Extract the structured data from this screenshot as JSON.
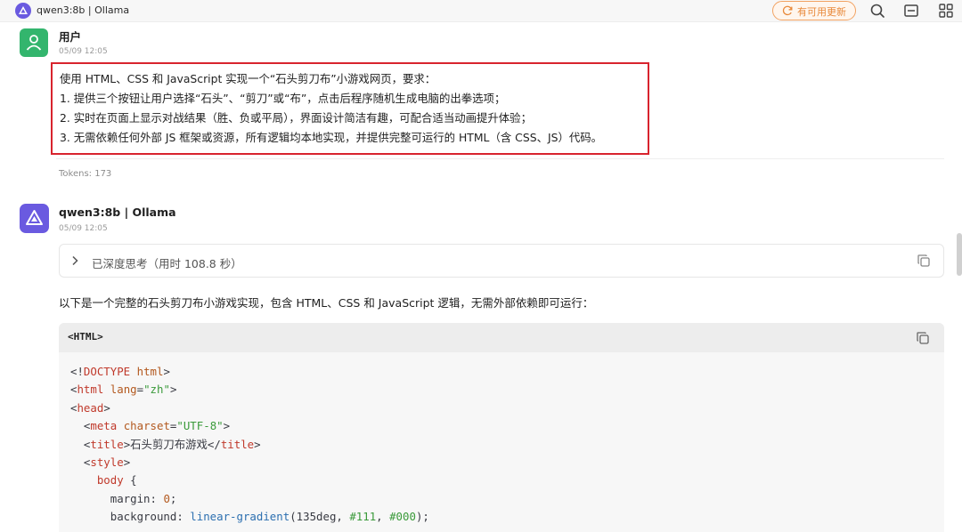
{
  "window": {
    "title": "qwen3:8b | Ollama",
    "update_button": "有可用更新",
    "icons": [
      "refresh-icon",
      "search-icon",
      "layout-icon",
      "grid-icon"
    ]
  },
  "user_message": {
    "sender": "用户",
    "timestamp": "05/09 12:05",
    "lines": [
      "使用 HTML、CSS 和 JavaScript 实现一个“石头剪刀布”小游戏网页，要求：",
      "1. 提供三个按钮让用户选择“石头”、“剪刀”或“布”，点击后程序随机生成电脑的出拳选项；",
      "2. 实时在页面上显示对战结果（胜、负或平局），界面设计简洁有趣，可配合适当动画提升体验；",
      "3. 无需依赖任何外部 JS 框架或资源，所有逻辑均本地实现，并提供完整可运行的 HTML（含 CSS、JS）代码。"
    ],
    "tokens": "Tokens: 173"
  },
  "assistant_message": {
    "sender": "qwen3:8b | Ollama",
    "timestamp": "05/09 12:05",
    "thinking_label": "已深度思考（用时 108.8 秒）",
    "intro": "以下是一个完整的石头剪刀布小游戏实现，包含 HTML、CSS 和 JavaScript 逻辑，无需外部依赖即可运行：",
    "code_lang": "<HTML>",
    "code_lines": [
      [
        {
          "t": "<!",
          "c": "plain"
        },
        {
          "t": "DOCTYPE",
          "c": "tag"
        },
        {
          "t": " ",
          "c": "plain"
        },
        {
          "t": "html",
          "c": "attr"
        },
        {
          "t": ">",
          "c": "plain"
        }
      ],
      [
        {
          "t": "<",
          "c": "plain"
        },
        {
          "t": "html",
          "c": "tag"
        },
        {
          "t": " ",
          "c": "plain"
        },
        {
          "t": "lang",
          "c": "attr"
        },
        {
          "t": "=",
          "c": "plain"
        },
        {
          "t": "\"zh\"",
          "c": "str"
        },
        {
          "t": ">",
          "c": "plain"
        }
      ],
      [
        {
          "t": "<",
          "c": "plain"
        },
        {
          "t": "head",
          "c": "tag"
        },
        {
          "t": ">",
          "c": "plain"
        }
      ],
      [
        {
          "t": "  <",
          "c": "plain"
        },
        {
          "t": "meta",
          "c": "tag"
        },
        {
          "t": " ",
          "c": "plain"
        },
        {
          "t": "charset",
          "c": "attr"
        },
        {
          "t": "=",
          "c": "plain"
        },
        {
          "t": "\"UTF-8\"",
          "c": "str"
        },
        {
          "t": ">",
          "c": "plain"
        }
      ],
      [
        {
          "t": "  <",
          "c": "plain"
        },
        {
          "t": "title",
          "c": "tag"
        },
        {
          "t": ">石头剪刀布游戏</",
          "c": "plain"
        },
        {
          "t": "title",
          "c": "tag"
        },
        {
          "t": ">",
          "c": "plain"
        }
      ],
      [
        {
          "t": "  <",
          "c": "plain"
        },
        {
          "t": "style",
          "c": "tag"
        },
        {
          "t": ">",
          "c": "plain"
        }
      ],
      [
        {
          "t": "    ",
          "c": "plain"
        },
        {
          "t": "body",
          "c": "tag"
        },
        {
          "t": " {",
          "c": "plain"
        }
      ],
      [
        {
          "t": "      margin",
          "c": "prop"
        },
        {
          "t": ": ",
          "c": "plain"
        },
        {
          "t": "0",
          "c": "num"
        },
        {
          "t": ";",
          "c": "plain"
        }
      ],
      [
        {
          "t": "      background",
          "c": "prop"
        },
        {
          "t": ": ",
          "c": "plain"
        },
        {
          "t": "linear-gradient",
          "c": "fn"
        },
        {
          "t": "(135deg, ",
          "c": "plain"
        },
        {
          "t": "#111",
          "c": "str"
        },
        {
          "t": ", ",
          "c": "plain"
        },
        {
          "t": "#000",
          "c": "str"
        },
        {
          "t": ");",
          "c": "plain"
        }
      ]
    ]
  }
}
